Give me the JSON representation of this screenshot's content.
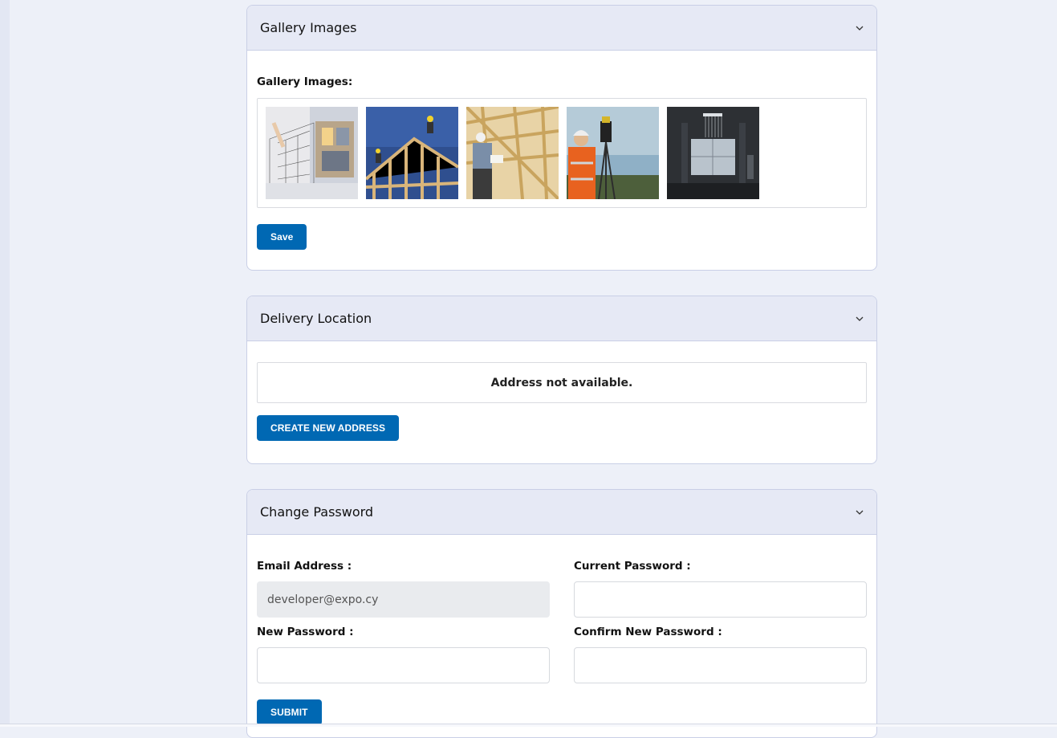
{
  "gallery": {
    "title": "Gallery Images",
    "label": "Gallery Images:",
    "images": [
      "architecture-sketch",
      "roof-framing-workers",
      "wood-frame-builder",
      "surveyor",
      "modern-bathroom"
    ],
    "save_label": "Save"
  },
  "delivery": {
    "title": "Delivery Location",
    "empty_message": "Address not available.",
    "create_label": "CREATE NEW ADDRESS"
  },
  "password": {
    "title": "Change Password",
    "email_label": "Email Address :",
    "email_value": "developer@expo.cy",
    "current_label": "Current Password :",
    "new_label": "New Password :",
    "confirm_label": "Confirm New Password :",
    "submit_label": "SUBMIT"
  },
  "colors": {
    "accent": "#0068b3",
    "header_bg": "#e6e9f5",
    "page_bg": "#edf0f8"
  }
}
